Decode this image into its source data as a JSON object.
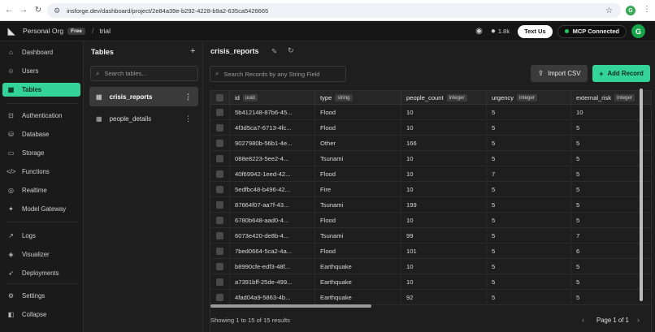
{
  "browser": {
    "url": "insforge.dev/dashboard/project/2e84a39e-b292-4228-b9a2-635ca5426665",
    "profile_initial": "G"
  },
  "header": {
    "org_name": "Personal Org",
    "plan_badge": "Free",
    "separator": "/",
    "project_name": "trial",
    "github_stars": "1.8k",
    "text_us_label": "Text Us",
    "mcp_label": "MCP Connected",
    "avatar_initial": "G"
  },
  "sidebar": {
    "items": [
      {
        "label": "Dashboard",
        "icon": "home-icon",
        "glyph": "⌂"
      },
      {
        "label": "Users",
        "icon": "users-icon",
        "glyph": "👥"
      },
      {
        "label": "Tables",
        "icon": "table-icon",
        "glyph": "▦"
      },
      {
        "label": "Authentication",
        "icon": "lock-icon",
        "glyph": "🔒"
      },
      {
        "label": "Database",
        "icon": "database-icon",
        "glyph": "⛁"
      },
      {
        "label": "Storage",
        "icon": "storage-icon",
        "glyph": "▭"
      },
      {
        "label": "Functions",
        "icon": "code-icon",
        "glyph": "</>"
      },
      {
        "label": "Realtime",
        "icon": "broadcast-icon",
        "glyph": "((·))"
      },
      {
        "label": "Model Gateway",
        "icon": "sparkles-icon",
        "glyph": "✦"
      },
      {
        "label": "Logs",
        "icon": "chart-line-icon",
        "glyph": "↗"
      },
      {
        "label": "Visualizer",
        "icon": "visualizer-icon",
        "glyph": "◈"
      },
      {
        "label": "Deployments",
        "icon": "rocket-icon",
        "glyph": "🚀"
      },
      {
        "label": "Settings",
        "icon": "gear-icon",
        "glyph": "⚙"
      },
      {
        "label": "Collapse",
        "icon": "collapse-icon",
        "glyph": "◧"
      }
    ]
  },
  "tables_panel": {
    "title": "Tables",
    "search_placeholder": "Search tables...",
    "tables": [
      {
        "name": "crisis_reports"
      },
      {
        "name": "people_details"
      }
    ]
  },
  "main": {
    "table_title": "crisis_reports",
    "search_placeholder": "Search Records by any String Field",
    "import_label": "Import CSV",
    "add_label": "Add Record",
    "columns": [
      {
        "name": "id",
        "type": "uuid"
      },
      {
        "name": "type",
        "type": "string"
      },
      {
        "name": "people_count",
        "type": "integer"
      },
      {
        "name": "urgency",
        "type": "integer"
      },
      {
        "name": "external_risk",
        "type": "integer"
      }
    ],
    "rows": [
      [
        "5b412148-87b6-45...",
        "Flood",
        "10",
        "5",
        "10"
      ],
      [
        "4f3d5ca7-6713-4fc...",
        "Flood",
        "10",
        "5",
        "5"
      ],
      [
        "9027980b-56b1-4e...",
        "Other",
        "166",
        "5",
        "5"
      ],
      [
        "088e8223-5ee2-4...",
        "Tsunami",
        "10",
        "5",
        "5"
      ],
      [
        "40f69942-1eed-42...",
        "Flood",
        "10",
        "7",
        "5"
      ],
      [
        "5edfbc48-b496-42...",
        "Fire",
        "10",
        "5",
        "5"
      ],
      [
        "87664f07-aa7f-43...",
        "Tsunami",
        "199",
        "5",
        "5"
      ],
      [
        "6780b648-aad0-4...",
        "Flood",
        "10",
        "5",
        "5"
      ],
      [
        "6073e420-de8b-4...",
        "Tsunami",
        "99",
        "5",
        "7"
      ],
      [
        "7bed0664-5ca2-4a...",
        "Flood",
        "101",
        "5",
        "6"
      ],
      [
        "b8990cfe-edf3-48f...",
        "Earthquake",
        "10",
        "5",
        "5"
      ],
      [
        "a7391bff-25de-499...",
        "Earthquake",
        "10",
        "5",
        "5"
      ],
      [
        "4fad04a9-5863-4b...",
        "Earthquake",
        "92",
        "5",
        "5"
      ]
    ],
    "footer_text": "Showing 1 to 15 of 15 results",
    "page_label": "Page 1 of 1"
  },
  "colors": {
    "accent": "#34d399",
    "mcp_dot": "#22c55e",
    "avatar": "#16a34a"
  }
}
